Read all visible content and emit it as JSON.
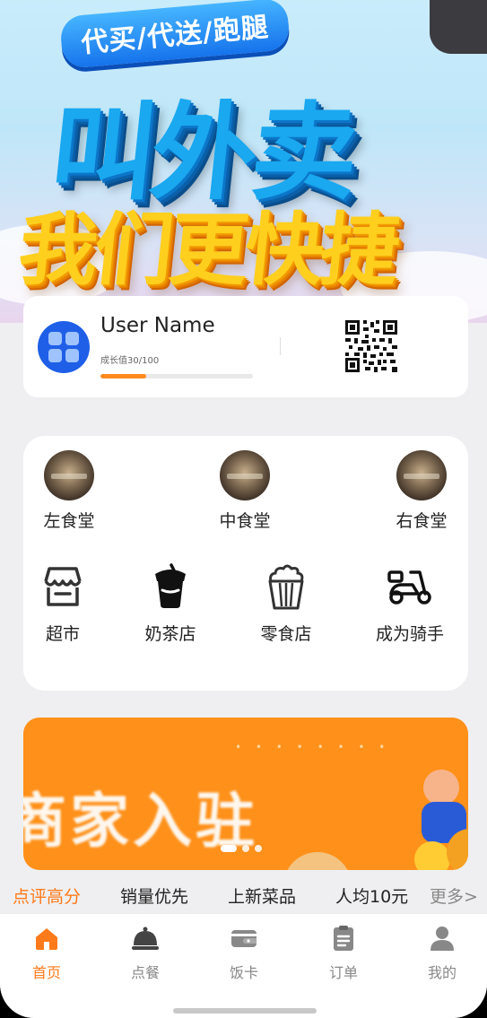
{
  "banner": {
    "pill_text": "代买/代送/跑腿",
    "headline": "叫外卖",
    "slogan": "我们更快捷"
  },
  "user": {
    "name": "User Name",
    "growth_text": "成长值30/100",
    "growth_progress": 0.3
  },
  "canteens": [
    {
      "label": "左食堂",
      "icon": "canteen-photo"
    },
    {
      "label": "中食堂",
      "icon": "canteen-photo"
    },
    {
      "label": "右食堂",
      "icon": "canteen-photo"
    }
  ],
  "shops": [
    {
      "label": "超市",
      "icon": "store-icon"
    },
    {
      "label": "奶茶店",
      "icon": "milk-tea-icon"
    },
    {
      "label": "零食店",
      "icon": "popcorn-icon"
    },
    {
      "label": "成为骑手",
      "icon": "scooter-icon"
    }
  ],
  "promo": {
    "text": "商家入驻",
    "slide_count": 3,
    "active_slide": 0
  },
  "filters": [
    {
      "label": "点评高分",
      "active": true
    },
    {
      "label": "销量优先",
      "active": false
    },
    {
      "label": "上新菜品",
      "active": false
    },
    {
      "label": "人均10元",
      "active": false
    },
    {
      "label": "更多>",
      "active": false
    }
  ],
  "nav": [
    {
      "label": "首页",
      "icon": "home-icon",
      "active": true
    },
    {
      "label": "点餐",
      "icon": "food-cover-icon",
      "active": false
    },
    {
      "label": "饭卡",
      "icon": "wallet-icon",
      "active": false
    },
    {
      "label": "订单",
      "icon": "clipboard-icon",
      "active": false
    },
    {
      "label": "我的",
      "icon": "user-icon",
      "active": false
    }
  ],
  "colors": {
    "accent": "#ff7a1a",
    "inactive": "#888888",
    "promo_bg": "#ff9019",
    "avatar_bg": "#1f5fe8"
  }
}
